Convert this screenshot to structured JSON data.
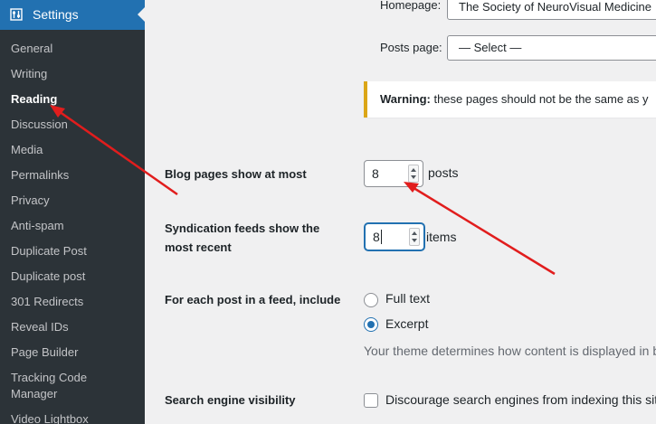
{
  "sidebar": {
    "header": "Settings",
    "items": [
      {
        "label": "General"
      },
      {
        "label": "Writing"
      },
      {
        "label": "Reading"
      },
      {
        "label": "Discussion"
      },
      {
        "label": "Media"
      },
      {
        "label": "Permalinks"
      },
      {
        "label": "Privacy"
      },
      {
        "label": "Anti-spam"
      },
      {
        "label": "Duplicate Post"
      },
      {
        "label": "Duplicate post"
      },
      {
        "label": "301 Redirects"
      },
      {
        "label": "Reveal IDs"
      },
      {
        "label": "Page Builder"
      },
      {
        "label": "Tracking Code Manager"
      },
      {
        "label": "Video Lightbox"
      }
    ]
  },
  "homepage": {
    "label": "Homepage:",
    "value": "The Society of NeuroVisual Medicine"
  },
  "posts_page": {
    "label": "Posts page:",
    "value": "— Select —"
  },
  "notice": {
    "strong": "Warning:",
    "text": " these pages should not be the same as y"
  },
  "blog_pages": {
    "label": "Blog pages show at most",
    "value": "8",
    "unit": "posts"
  },
  "syndication": {
    "label_line1": "Syndication feeds show the",
    "label_line2": "most recent",
    "value": "8",
    "unit": "items"
  },
  "feed_include": {
    "label": "For each post in a feed, include",
    "options": [
      {
        "label": "Full text"
      },
      {
        "label": "Excerpt"
      }
    ],
    "description": "Your theme determines how content is displayed in b"
  },
  "search_visibility": {
    "label": "Search engine visibility",
    "checkbox_label": "Discourage search engines from indexing this site"
  },
  "colors": {
    "sidebar_bg": "#2c3338",
    "active_blue": "#2271b1",
    "warning_border": "#dba617",
    "annotation_arrow": "#e11d1d"
  }
}
